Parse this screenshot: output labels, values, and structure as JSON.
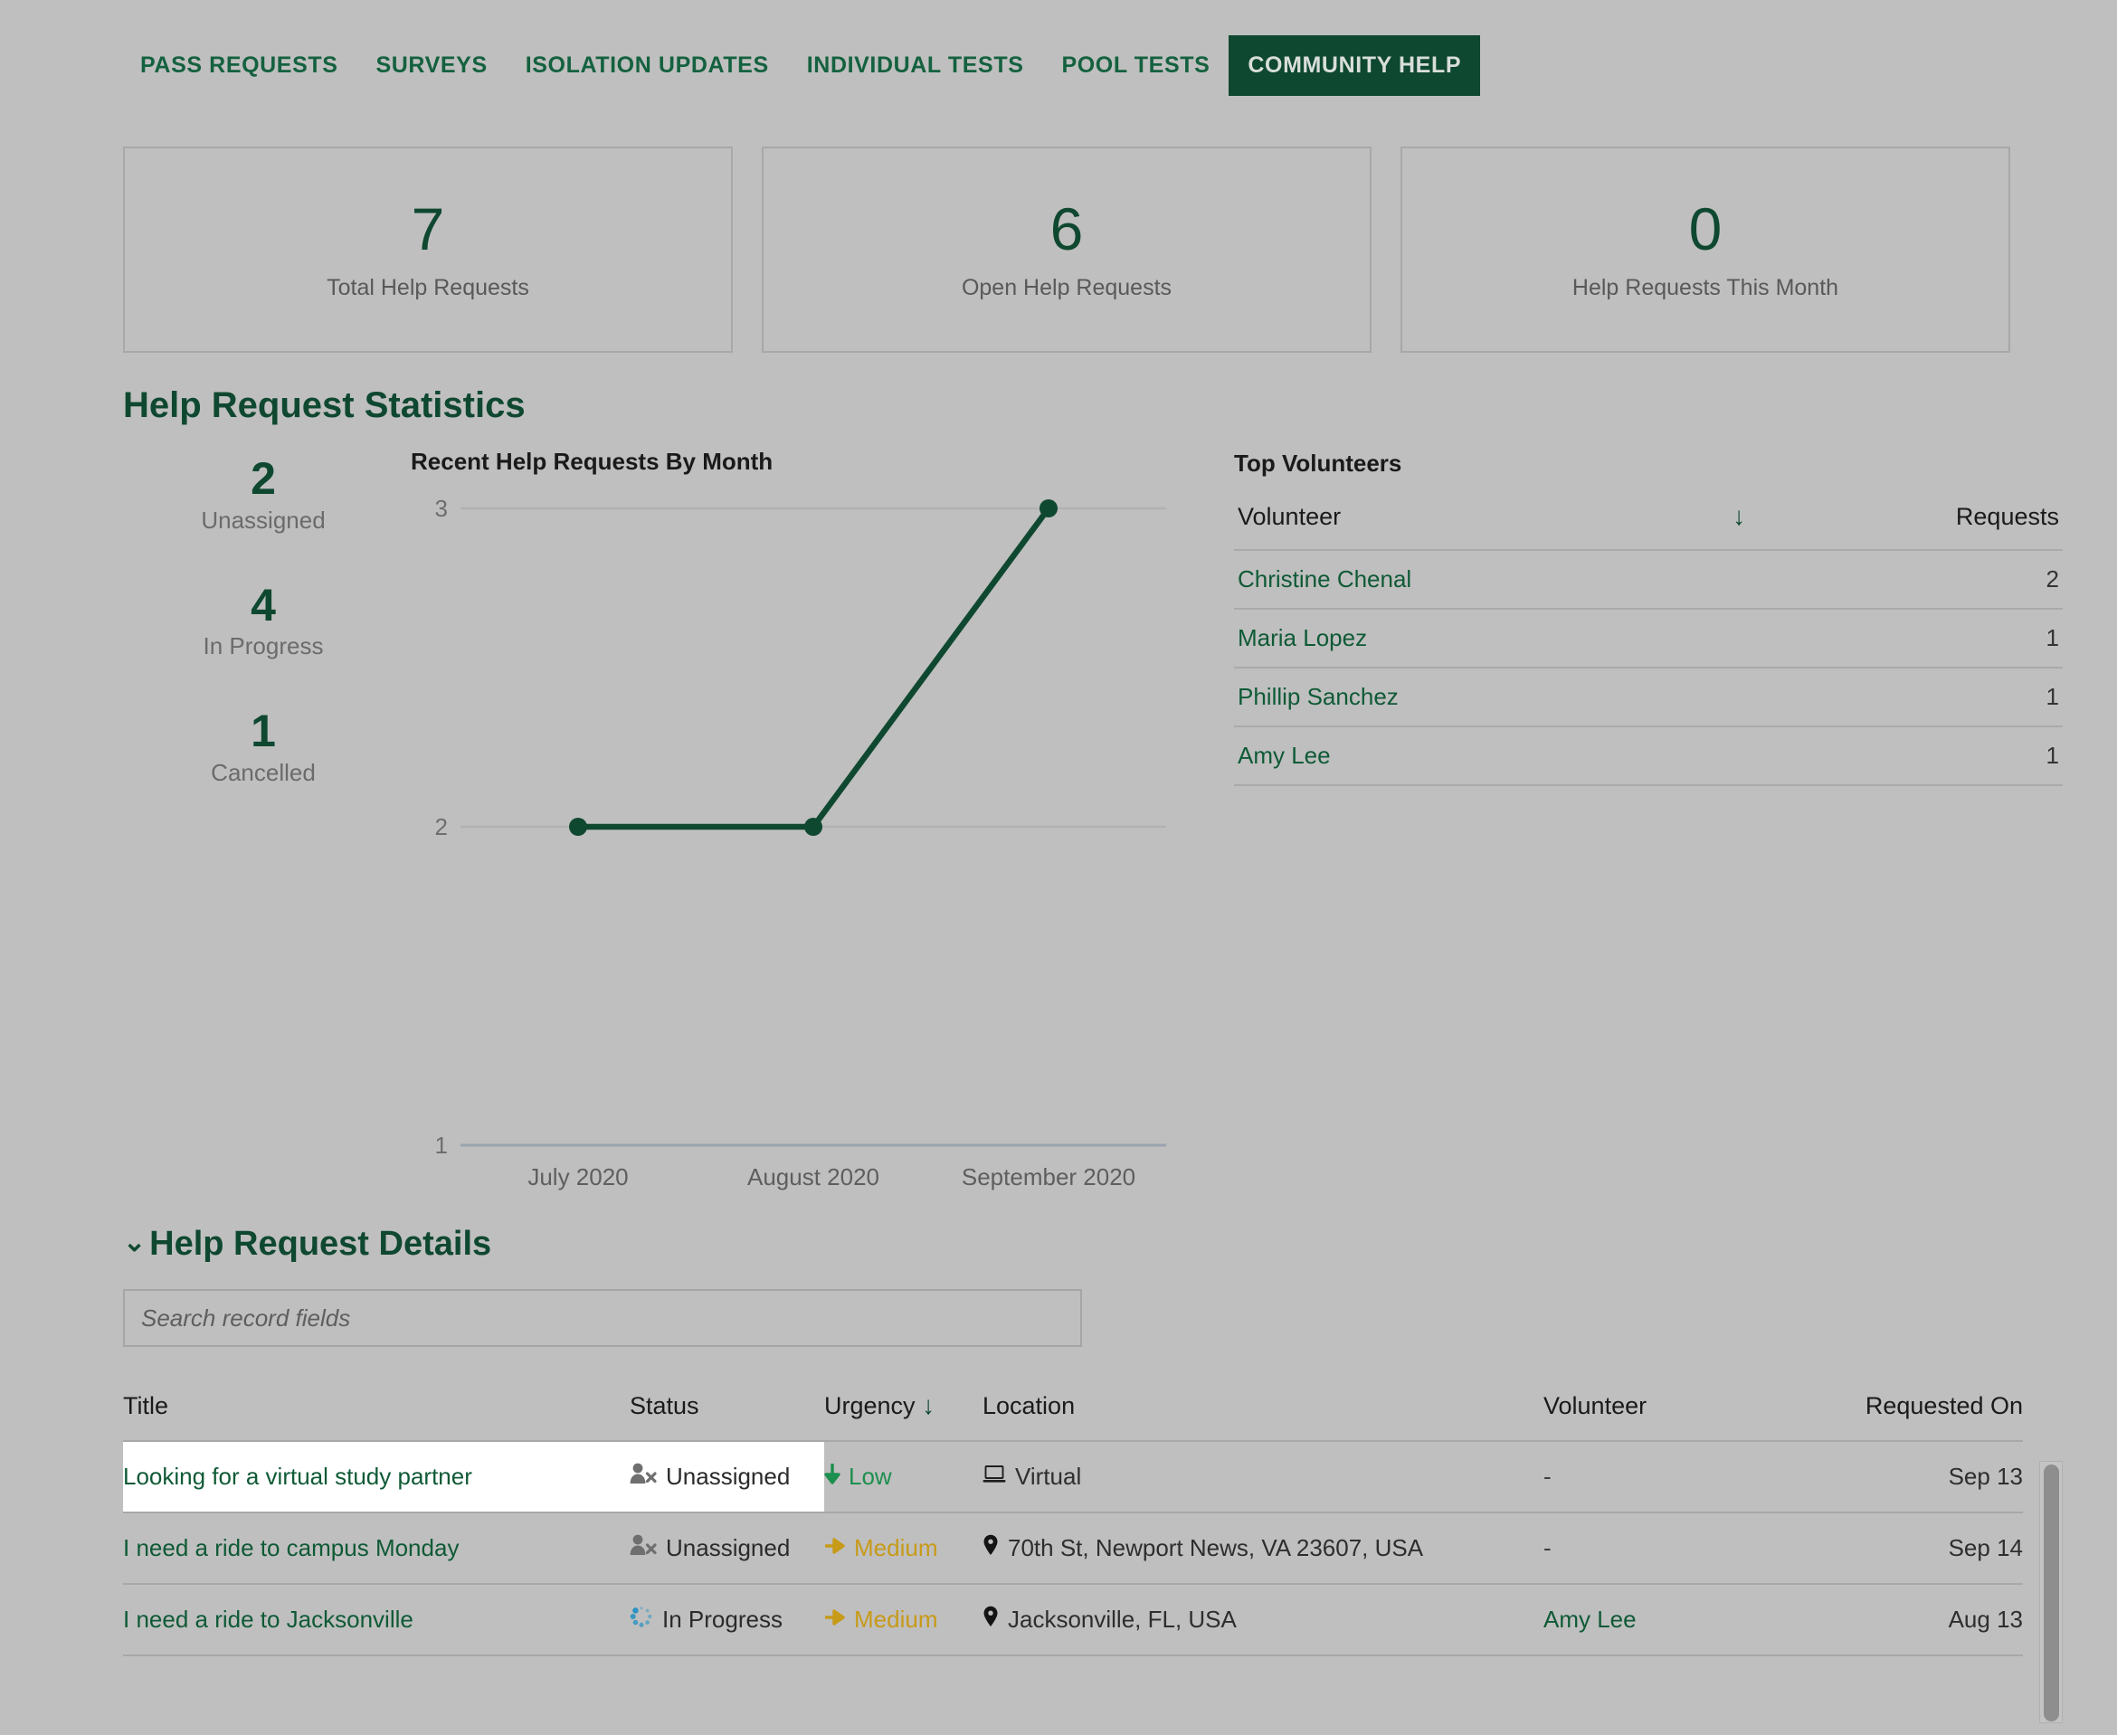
{
  "nav": {
    "items": [
      {
        "label": "PASS REQUESTS",
        "active": false
      },
      {
        "label": "SURVEYS",
        "active": false
      },
      {
        "label": "ISOLATION UPDATES",
        "active": false
      },
      {
        "label": "INDIVIDUAL TESTS",
        "active": false
      },
      {
        "label": "POOL TESTS",
        "active": false
      },
      {
        "label": "COMMUNITY HELP",
        "active": true
      }
    ]
  },
  "kpis": [
    {
      "value": "7",
      "label": "Total Help Requests"
    },
    {
      "value": "6",
      "label": "Open Help Requests"
    },
    {
      "value": "0",
      "label": "Help Requests This Month"
    }
  ],
  "statistics": {
    "heading": "Help Request Statistics",
    "statuses": [
      {
        "value": "2",
        "label": "Unassigned"
      },
      {
        "value": "4",
        "label": "In Progress"
      },
      {
        "value": "1",
        "label": "Cancelled"
      }
    ]
  },
  "chart_data": {
    "type": "line",
    "title": "Recent Help Requests By Month",
    "categories": [
      "July 2020",
      "August 2020",
      "September 2020"
    ],
    "values": [
      2,
      2,
      3
    ],
    "xlabel": "",
    "ylabel": "",
    "yticks": [
      1,
      2,
      3
    ],
    "ylim": [
      1,
      3
    ],
    "grid": true,
    "legend": "none",
    "series_color": "#0f4830"
  },
  "volunteers": {
    "title": "Top Volunteers",
    "columns": {
      "name": "Volunteer",
      "requests": "Requests"
    },
    "sort_icon": "arrow-down-icon",
    "rows": [
      {
        "name": "Christine Chenal",
        "requests": "2"
      },
      {
        "name": "Maria Lopez",
        "requests": "1"
      },
      {
        "name": "Phillip Sanchez",
        "requests": "1"
      },
      {
        "name": "Amy Lee",
        "requests": "1"
      }
    ]
  },
  "details": {
    "heading": "Help Request Details",
    "search_placeholder": "Search record fields",
    "search_value": "",
    "columns": {
      "title": "Title",
      "status": "Status",
      "urgency": "Urgency",
      "location": "Location",
      "volunteer": "Volunteer",
      "requested_on": "Requested On"
    },
    "rows": [
      {
        "title": "Looking for a virtual study partner",
        "status": "Unassigned",
        "status_icon": "user-x-icon",
        "urgency": "Low",
        "urgency_icon": "arrow-down-icon",
        "location": "Virtual",
        "location_icon": "laptop-icon",
        "volunteer": "-",
        "requested_on": "Sep 13",
        "highlighted": true
      },
      {
        "title": "I need a ride to campus Monday",
        "status": "Unassigned",
        "status_icon": "user-x-icon",
        "urgency": "Medium",
        "urgency_icon": "arrow-right-icon",
        "location": "70th St, Newport News, VA 23607, USA",
        "location_icon": "map-pin-icon",
        "volunteer": "-",
        "requested_on": "Sep 14",
        "highlighted": false
      },
      {
        "title": "I need a ride to Jacksonville",
        "status": "In Progress",
        "status_icon": "spinner-icon",
        "urgency": "Medium",
        "urgency_icon": "arrow-right-icon",
        "location": "Jacksonville, FL, USA",
        "location_icon": "map-pin-icon",
        "volunteer": "Amy Lee",
        "requested_on": "Aug 13",
        "highlighted": false
      }
    ]
  },
  "colors": {
    "brand_green": "#0f4830",
    "link_green": "#0f5a36",
    "low_urgency": "#1d8f4e",
    "medium_urgency": "#c79a18",
    "page_background": "#bfbfbf"
  }
}
